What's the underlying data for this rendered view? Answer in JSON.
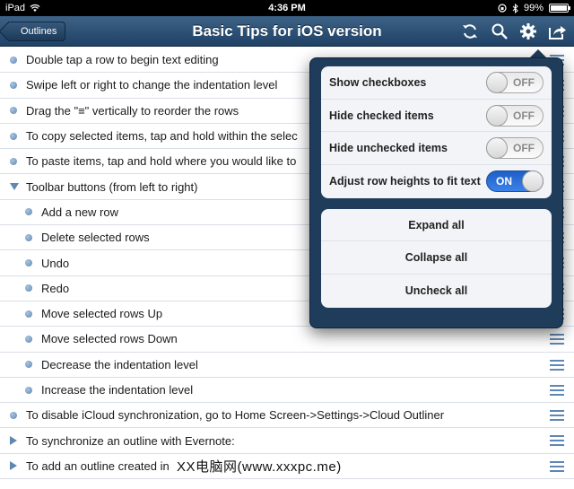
{
  "status_bar": {
    "device": "iPad",
    "time": "4:36 PM",
    "battery": "99%",
    "battery_level": 0.99
  },
  "nav": {
    "back_label": "Outlines",
    "title": "Basic Tips for iOS version",
    "icons": [
      "refresh-icon",
      "search-icon",
      "gear-icon",
      "share-icon"
    ]
  },
  "rows": [
    {
      "text": "Double tap a row to begin text editing",
      "level": 0,
      "marker": "bullet"
    },
    {
      "text": "Swipe left or right to change the indentation level",
      "level": 0,
      "marker": "bullet"
    },
    {
      "text": "Drag the \"≡\" vertically to reorder the rows",
      "level": 0,
      "marker": "bullet"
    },
    {
      "text": "To copy selected items, tap and hold within the selec",
      "level": 0,
      "marker": "bullet"
    },
    {
      "text": "To paste items, tap and hold where you would like to",
      "level": 0,
      "marker": "bullet"
    },
    {
      "text": "Toolbar buttons (from left to right)",
      "level": 0,
      "marker": "expanded"
    },
    {
      "text": "Add a new row",
      "level": 1,
      "marker": "bullet"
    },
    {
      "text": "Delete selected rows",
      "level": 1,
      "marker": "bullet"
    },
    {
      "text": "Undo",
      "level": 1,
      "marker": "bullet"
    },
    {
      "text": "Redo",
      "level": 1,
      "marker": "bullet"
    },
    {
      "text": "Move selected rows Up",
      "level": 1,
      "marker": "bullet"
    },
    {
      "text": "Move selected rows Down",
      "level": 1,
      "marker": "bullet"
    },
    {
      "text": "Decrease the indentation level",
      "level": 1,
      "marker": "bullet"
    },
    {
      "text": "Increase the indentation level",
      "level": 1,
      "marker": "bullet"
    },
    {
      "text": "To disable iCloud synchronization, go to Home Screen->Settings->Cloud Outliner",
      "level": 0,
      "marker": "bullet"
    },
    {
      "text": "To synchronize an outline with Evernote:",
      "level": 0,
      "marker": "collapsed"
    },
    {
      "text": "To add an outline created in",
      "level": 0,
      "marker": "collapsed"
    }
  ],
  "popover": {
    "toggles": [
      {
        "label": "Show checkboxes",
        "state": "OFF",
        "on": false
      },
      {
        "label": "Hide checked items",
        "state": "OFF",
        "on": false
      },
      {
        "label": "Hide unchecked items",
        "state": "OFF",
        "on": false
      },
      {
        "label": "Adjust row heights to fit text",
        "state": "ON",
        "on": true
      }
    ],
    "actions": [
      "Expand all",
      "Collapse all",
      "Uncheck all"
    ]
  },
  "watermark": "XX电脑网(www.xxxpc.me)",
  "colors": {
    "nav_bar": "#2a4e73",
    "popover": "#1f3c5b",
    "bullet": "#5f87b3",
    "switch_on": "#2a6fd8"
  }
}
